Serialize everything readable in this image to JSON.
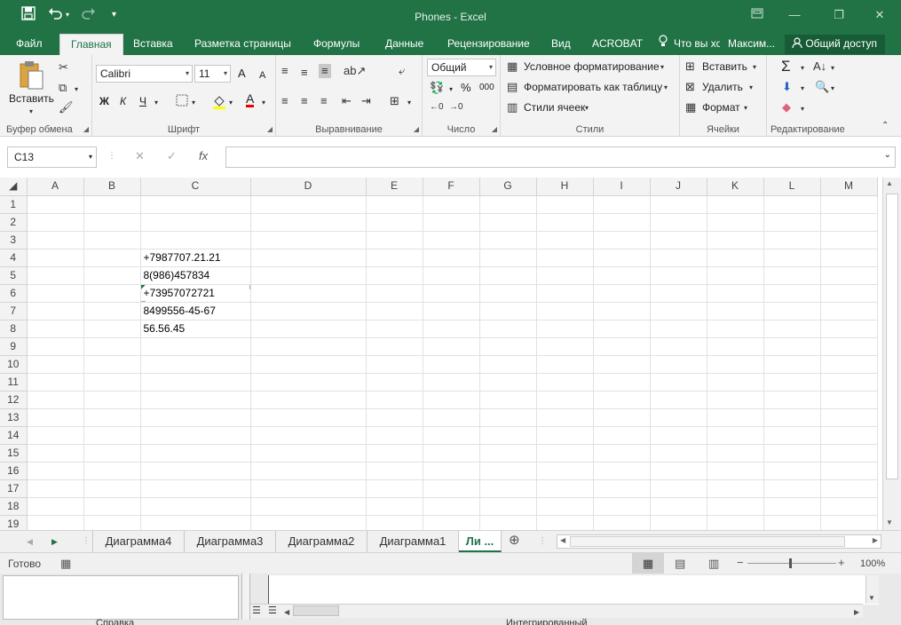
{
  "window": {
    "title": "Phones - Excel",
    "minimize": "—",
    "restore": "❐",
    "close": "✕"
  },
  "quick_access": {
    "save_icon": "save-icon",
    "undo_icon": "undo-icon",
    "redo_icon": "redo-icon"
  },
  "tabs": [
    {
      "label": "Файл"
    },
    {
      "label": "Главная"
    },
    {
      "label": "Вставка"
    },
    {
      "label": "Разметка страницы"
    },
    {
      "label": "Формулы"
    },
    {
      "label": "Данные"
    },
    {
      "label": "Рецензирование"
    },
    {
      "label": "Вид"
    },
    {
      "label": "ACROBAT"
    }
  ],
  "tell_me": "Что вы хо",
  "user": "Максим...",
  "share": "Общий доступ",
  "ribbon": {
    "clipboard": {
      "paste": "Вставить",
      "label": "Буфер обмена"
    },
    "font": {
      "name": "Calibri",
      "size": "11",
      "bold": "Ж",
      "italic": "К",
      "underline": "Ч",
      "grow": "A",
      "shrink": "A",
      "color_letter": "A",
      "label": "Шрифт"
    },
    "alignment": {
      "label": "Выравнивание"
    },
    "number": {
      "format": "Общий",
      "percent": "%",
      "thousands": "000",
      "label": "Число"
    },
    "styles": {
      "conditional": "Условное форматирование",
      "as_table": "Форматировать как таблицу",
      "cell_styles": "Стили ячеек",
      "label": "Стили"
    },
    "cells": {
      "insert": "Вставить",
      "delete": "Удалить",
      "format": "Формат",
      "label": "Ячейки"
    },
    "editing": {
      "sum": "Σ",
      "label": "Редактирование"
    }
  },
  "formula_bar": {
    "name_box": "C13",
    "fx": "fx",
    "content": ""
  },
  "columns": [
    "A",
    "B",
    "C",
    "D",
    "E",
    "F",
    "G",
    "H",
    "I",
    "J",
    "K",
    "L",
    "M"
  ],
  "rows": [
    {
      "num": "1",
      "c": ""
    },
    {
      "num": "2",
      "c": ""
    },
    {
      "num": "3",
      "c": ""
    },
    {
      "num": "4",
      "c": "+7987707.21.21"
    },
    {
      "num": "5",
      "c": "8(986)457834"
    },
    {
      "num": "6",
      "c": "+73957072721"
    },
    {
      "num": "7",
      "c": "8499556-45-67"
    },
    {
      "num": "8",
      "c": "56.56.45"
    },
    {
      "num": "9",
      "c": ""
    },
    {
      "num": "10",
      "c": ""
    },
    {
      "num": "11",
      "c": ""
    },
    {
      "num": "12",
      "c": ""
    },
    {
      "num": "13",
      "c": ""
    },
    {
      "num": "14",
      "c": ""
    },
    {
      "num": "15",
      "c": ""
    },
    {
      "num": "16",
      "c": ""
    },
    {
      "num": "17",
      "c": ""
    },
    {
      "num": "18",
      "c": ""
    },
    {
      "num": "19",
      "c": ""
    }
  ],
  "sheets": [
    {
      "label": "Диаграмма4"
    },
    {
      "label": "Диаграмма3"
    },
    {
      "label": "Диаграмма2"
    },
    {
      "label": "Диаграмма1"
    },
    {
      "label": "Ли ..."
    }
  ],
  "status": {
    "ready": "Готово",
    "zoom": "100%"
  },
  "background": {
    "text1": "Справка",
    "text2": "Интегрированный"
  },
  "colors": {
    "accent": "#217346",
    "share": "#185c37",
    "ribbon": "#f3f3f3"
  }
}
